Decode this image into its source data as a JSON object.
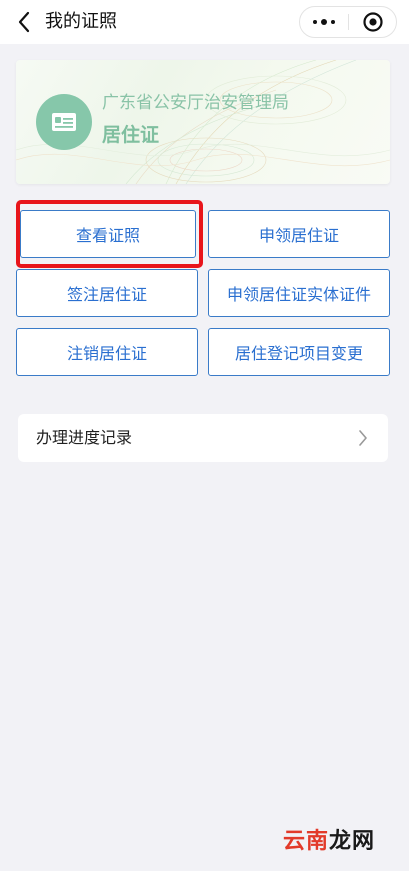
{
  "header": {
    "title": "我的证照"
  },
  "card": {
    "issuer": "广东省公安厅治安管理局",
    "certificate_type": "居住证",
    "accent_color": "#85c7ab"
  },
  "actions": [
    {
      "label": "查看证照",
      "highlighted": true
    },
    {
      "label": "申领居住证"
    },
    {
      "label": "签注居住证"
    },
    {
      "label": "申领居住证实体证件"
    },
    {
      "label": "注销居住证"
    },
    {
      "label": "居住登记项目变更"
    }
  ],
  "record": {
    "label": "办理进度记录"
  },
  "watermark": {
    "part1": "云南",
    "part2": "龙网"
  },
  "colors": {
    "button_border": "#3a7bc8",
    "button_text": "#2a6fd0",
    "highlight_box": "#e8151b",
    "background": "#f2f2f6"
  }
}
